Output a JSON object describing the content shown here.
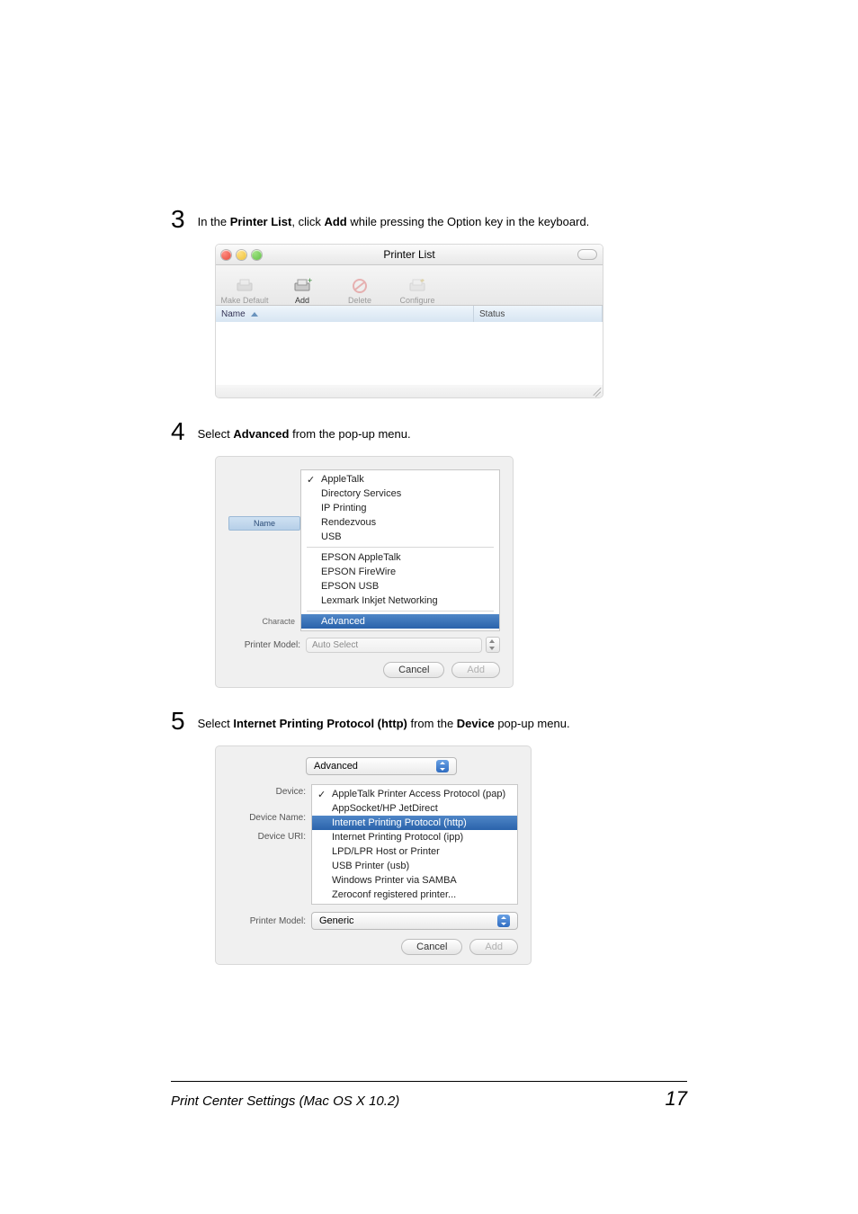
{
  "steps": {
    "s3": {
      "num": "3",
      "text_pre": "In the ",
      "b1": "Printer List",
      "mid1": ", click ",
      "b2": "Add",
      "post": " while pressing the Option key in the keyboard."
    },
    "s4": {
      "num": "4",
      "pre": "Select ",
      "b1": "Advanced",
      "post": " from the pop-up menu."
    },
    "s5": {
      "num": "5",
      "pre": "Select ",
      "b1": "Internet Printing Protocol (http)",
      "mid": " from the ",
      "b2": "Device",
      "post": " pop-up menu."
    }
  },
  "shot1": {
    "title": "Printer List",
    "tb": {
      "make_default": "Make Default",
      "add": "Add",
      "delete": "Delete",
      "configure": "Configure"
    },
    "cols": {
      "name": "Name",
      "status": "Status"
    }
  },
  "shot2": {
    "left": {
      "name": "Name",
      "characte": "Characte"
    },
    "items": [
      "AppleTalk",
      "Directory Services",
      "IP Printing",
      "Rendezvous",
      "USB"
    ],
    "items2": [
      "EPSON AppleTalk",
      "EPSON FireWire",
      "EPSON USB",
      "Lexmark Inkjet Networking"
    ],
    "advanced": "Advanced",
    "model_label": "Printer Model:",
    "model_value": "Auto Select",
    "cancel": "Cancel",
    "add": "Add"
  },
  "shot3": {
    "topsel": "Advanced",
    "labels": {
      "device": "Device:",
      "dname": "Device Name:",
      "duri": "Device URI:"
    },
    "items_top": [
      "AppleTalk Printer Access Protocol (pap)",
      "AppSocket/HP JetDirect"
    ],
    "sel": "Internet Printing Protocol (http)",
    "items_bot": [
      "Internet Printing Protocol (ipp)",
      "LPD/LPR Host or Printer",
      "USB Printer (usb)",
      "Windows Printer via SAMBA",
      "Zeroconf registered printer..."
    ],
    "model_label": "Printer Model:",
    "model_value": "Generic",
    "cancel": "Cancel",
    "add": "Add"
  },
  "footer": {
    "title": "Print Center Settings (Mac OS X 10.2)",
    "page": "17"
  }
}
